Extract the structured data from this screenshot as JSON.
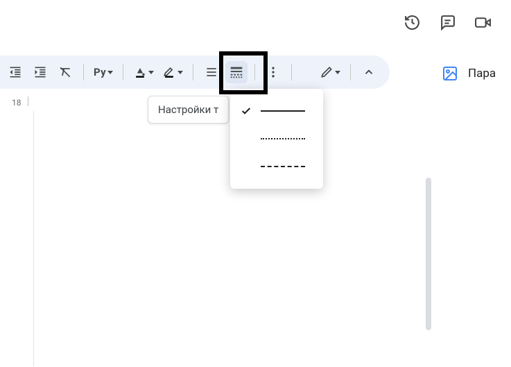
{
  "top_actions": {
    "history_icon": "history-icon",
    "comment_icon": "comment-icon",
    "present_icon": "video-icon"
  },
  "toolbar": {
    "indent_decrease": "indent-decrease",
    "indent_increase": "indent-increase",
    "clear_formatting": "clear-formatting",
    "py_label": "Pу",
    "fill_color": "fill-color",
    "highlight_color": "highlight-color",
    "line_spacing": "line-spacing",
    "border_style": "border-style",
    "more": "more",
    "pen": "pen",
    "collapse": "collapse"
  },
  "tooltip": {
    "text": "Настройки т"
  },
  "dropdown": {
    "options": [
      {
        "style": "solid",
        "selected": true
      },
      {
        "style": "dotted",
        "selected": false
      },
      {
        "style": "dashed",
        "selected": false
      }
    ]
  },
  "right_panel": {
    "label": "Пара"
  },
  "ruler": {
    "number": "18"
  }
}
